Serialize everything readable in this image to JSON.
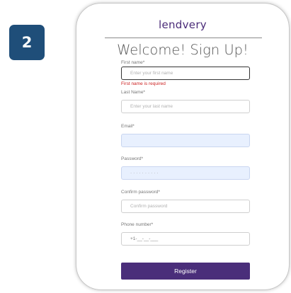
{
  "step_badge": "2",
  "brand": {
    "logo_text": "lendvery"
  },
  "form": {
    "title": "Welcome! Sign Up!",
    "first_name": {
      "label": "First name*",
      "placeholder": "Enter your first name",
      "error": "First name is required"
    },
    "last_name": {
      "label": "Last Name*",
      "placeholder": "Enter your last name"
    },
    "email": {
      "label": "Email*",
      "value": ""
    },
    "password": {
      "label": "Password*",
      "value": "··········"
    },
    "confirm_password": {
      "label": "Confirm password*",
      "placeholder": "Confirm password"
    },
    "phone": {
      "label": "Phone number*",
      "value": "+1-__-__-___"
    },
    "register_label": "Register"
  },
  "colors": {
    "badge": "#1f4e79",
    "brand": "#4a2b78",
    "button": "#4a2e7a",
    "error": "#cc2222",
    "autofill": "#e8f0fe"
  }
}
